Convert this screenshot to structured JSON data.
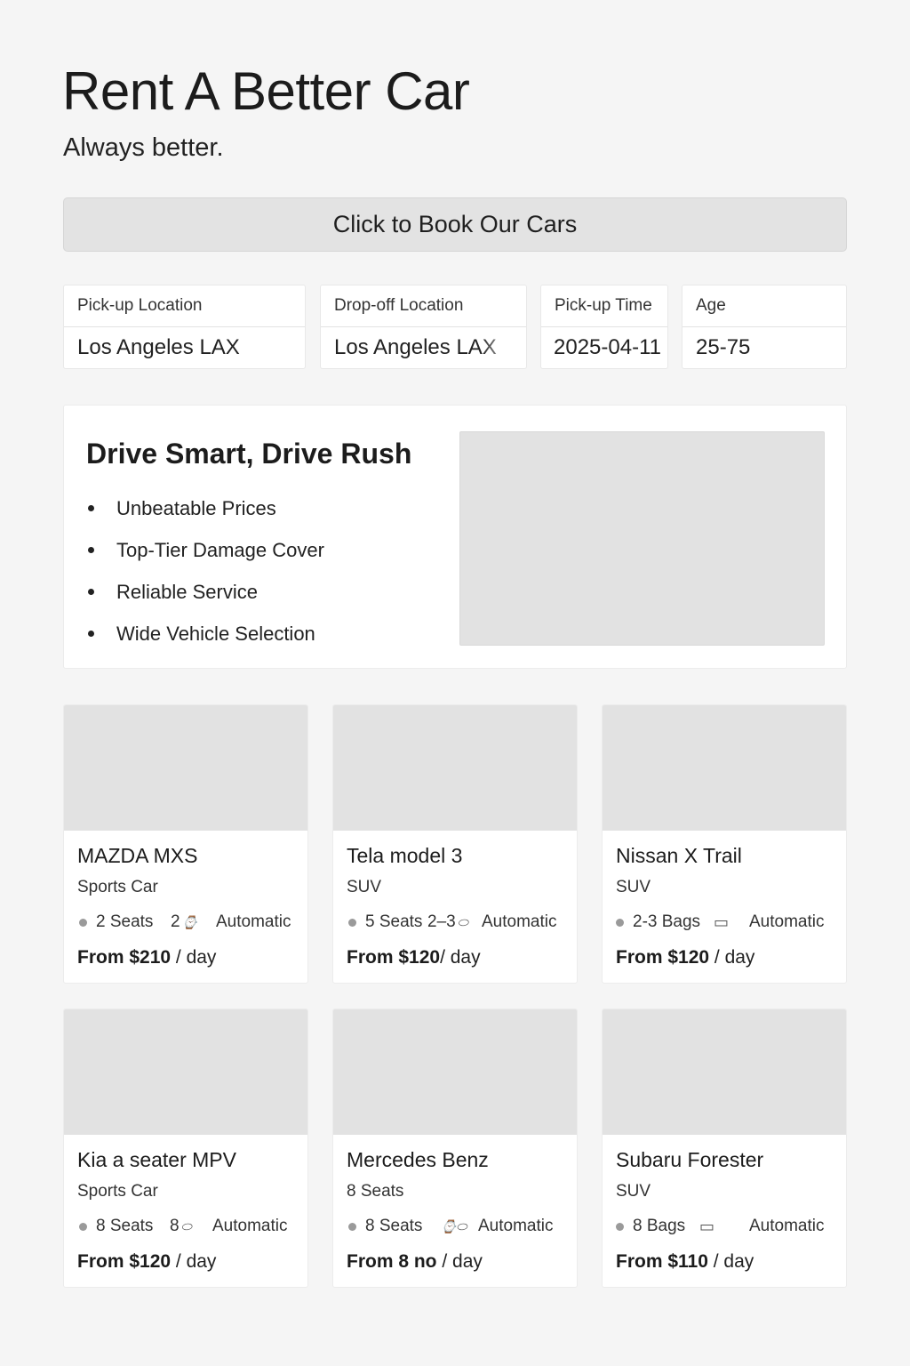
{
  "header": {
    "title": "Rent A Better Car",
    "subtitle": "Always better."
  },
  "booking": {
    "button_label": "Click to Book Our Cars",
    "fields": [
      {
        "label": "Pick-up Location",
        "value": "Los Angeles LAX"
      },
      {
        "label": "Drop-off Location",
        "value": "Los Angeles LAX"
      },
      {
        "label": "Pick-up Time",
        "value": "2025-04-11"
      },
      {
        "label": "Age",
        "value": "25-75"
      }
    ]
  },
  "promo": {
    "title": "Drive Smart, Drive Rush",
    "features": [
      "Unbeatable Prices",
      "Top-Tier Damage Cover",
      "Reliable Service",
      "Wide Vehicle Selection"
    ]
  },
  "cars": [
    {
      "name": "MAZDA MXS",
      "category": "Sports Car",
      "spec_a": "2 Seats",
      "spec_b": "2",
      "spec_b_icon": "seat-icon",
      "transmission": "Automatic",
      "price": "From $210",
      "unit": "/ day"
    },
    {
      "name": "Tela model 3",
      "category": "SUV",
      "spec_a": "5 Seats",
      "spec_b": "2–3",
      "spec_b_icon": "bag-icon",
      "transmission": "Automatic",
      "price": "From $120",
      "unit": "/ day"
    },
    {
      "name": "Nissan X Trail",
      "category": "SUV",
      "spec_a": "2-3 Bags",
      "spec_b": "",
      "spec_b_icon": "bag-icon",
      "transmission": "Automatic",
      "price": "From $120",
      "unit": "/ day"
    },
    {
      "name": "Kia a seater MPV",
      "category": "Sports Car",
      "spec_a": "8 Seats",
      "spec_b": "8",
      "spec_b_icon": "bag-icon",
      "transmission": "Automatic",
      "price": "From $120",
      "unit": "/ day"
    },
    {
      "name": "Mercedes Benz",
      "category": "8 Seats",
      "spec_a": "8 Seats",
      "spec_b": "",
      "spec_b_icon": "seat-icon",
      "transmission": "Automatic",
      "price": "From 8 no",
      "unit": "/ day"
    },
    {
      "name": "Subaru Forester",
      "category": "SUV",
      "spec_a": "8 Bags",
      "spec_b": "",
      "spec_b_icon": "bag-icon",
      "transmission": "Automatic",
      "price": "From $110",
      "unit": "/ day"
    }
  ]
}
